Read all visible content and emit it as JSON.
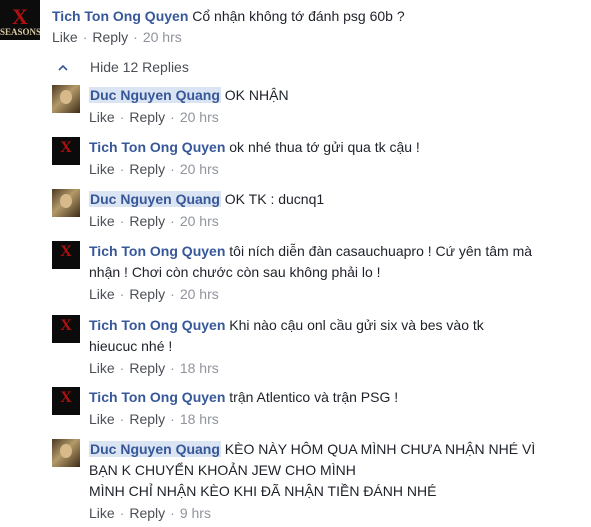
{
  "top_comment": {
    "author": "Tich Ton Ong Quyen",
    "text": "Cổ nhận không tớ đánh psg 60b ?",
    "like": "Like",
    "reply": "Reply",
    "time": "20 hrs",
    "avatar_logo": "SEASONS",
    "avatar_x": "X"
  },
  "hide_replies_label": "Hide 12 Replies",
  "replies": [
    {
      "author": "Duc Nguyen Quang",
      "text": "OK NHẬN",
      "like": "Like",
      "reply": "Reply",
      "time": "20 hrs",
      "avatar": "duc"
    },
    {
      "author": "Tich Ton Ong Quyen",
      "text": "ok nhé thua tớ gửi qua tk cậu !",
      "like": "Like",
      "reply": "Reply",
      "time": "20 hrs",
      "avatar": "seasons"
    },
    {
      "author": "Duc Nguyen Quang",
      "text": "OK TK : ducnq1",
      "like": "Like",
      "reply": "Reply",
      "time": "20 hrs",
      "avatar": "duc"
    },
    {
      "author": "Tich Ton Ong Quyen",
      "text": "tôi ních diễn đàn casauchuapro ! Cứ yên tâm mà nhận ! Chơi còn chước còn sau không phải lo !",
      "like": "Like",
      "reply": "Reply",
      "time": "20 hrs",
      "avatar": "seasons"
    },
    {
      "author": "Tich Ton Ong Quyen",
      "text": "Khi nào cậu onl cầu gửi six và bes vào tk hieucuc nhé !",
      "like": "Like",
      "reply": "Reply",
      "time": "18 hrs",
      "avatar": "seasons"
    },
    {
      "author": "Tich Ton Ong Quyen",
      "text": "trận Atlentico và trận PSG !",
      "like": "Like",
      "reply": "Reply",
      "time": "18 hrs",
      "avatar": "seasons"
    },
    {
      "author": "Duc Nguyen Quang",
      "text": "KÈO NÀY HÔM QUA MÌNH CHƯA NHẬN NHÉ VÌ BẠN K CHUYỂN KHOẢN JEW CHO MÌNH",
      "text2": "MÌNH CHỈ NHẬN KÈO KHI ĐÃ NHẬN TIỀN ĐÁNH NHÉ",
      "like": "Like",
      "reply": "Reply",
      "time": "9 hrs",
      "avatar": "duc"
    }
  ],
  "colors": {
    "author": "#365899",
    "text": "#1d2129",
    "meta": "#90949c",
    "highlight": "#dbe4f2"
  }
}
